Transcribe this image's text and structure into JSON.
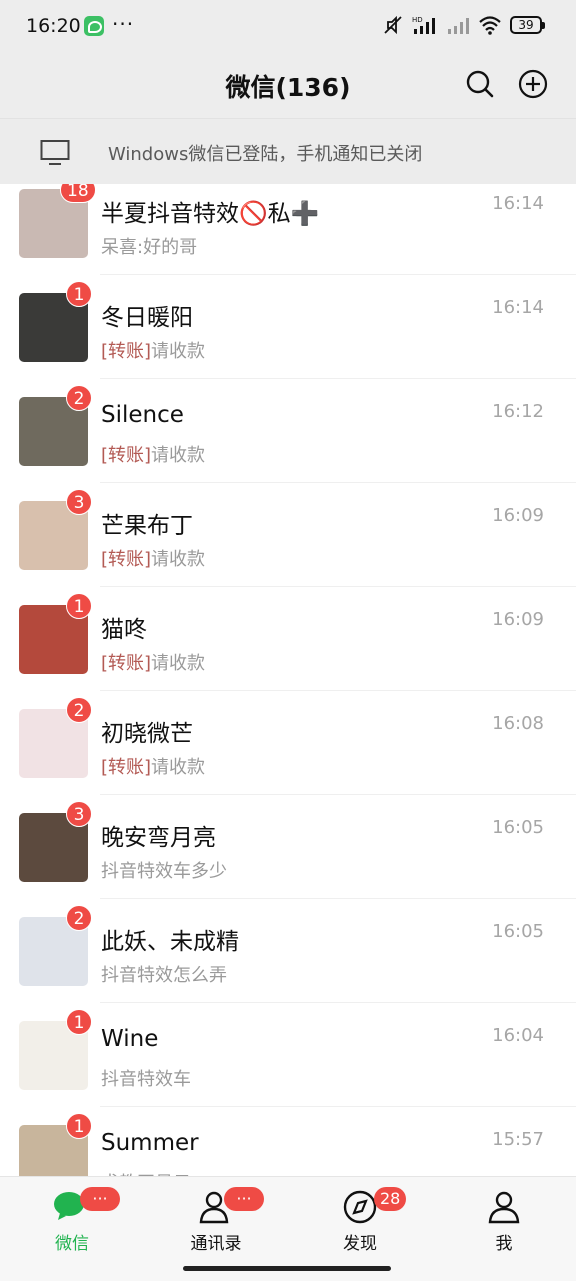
{
  "status": {
    "time": "16:20",
    "dots": "···",
    "battery": "39"
  },
  "header": {
    "title": "微信(136)"
  },
  "notice": {
    "text": "Windows微信已登陆，手机通知已关闭"
  },
  "chats": [
    {
      "name": "半夏抖音特效🚫私➕",
      "tag": "",
      "preview": "呆喜:好的哥",
      "time": "16:14",
      "badge": "18",
      "avatar_color": "#c9b9b3"
    },
    {
      "name": "冬日暖阳",
      "tag": "[转账]",
      "preview": "请收款",
      "time": "16:14",
      "badge": "1",
      "avatar_color": "#3a3a38"
    },
    {
      "name": "Silence",
      "tag": "[转账]",
      "preview": "请收款",
      "time": "16:12",
      "badge": "2",
      "avatar_color": "#6f6a5e"
    },
    {
      "name": "芒果布丁",
      "tag": "[转账]",
      "preview": "请收款",
      "time": "16:09",
      "badge": "3",
      "avatar_color": "#d8c0ad"
    },
    {
      "name": "猫咚",
      "tag": "[转账]",
      "preview": "请收款",
      "time": "16:09",
      "badge": "1",
      "avatar_color": "#b4493c"
    },
    {
      "name": "初晓微芒",
      "tag": "[转账]",
      "preview": "请收款",
      "time": "16:08",
      "badge": "2",
      "avatar_color": "#f1e2e4"
    },
    {
      "name": "晚安弯月亮",
      "tag": "",
      "preview": "抖音特效车多少",
      "time": "16:05",
      "badge": "3",
      "avatar_color": "#5c4a3e"
    },
    {
      "name": "此妖、未成精",
      "tag": "",
      "preview": "抖音特效怎么弄",
      "time": "16:05",
      "badge": "2",
      "avatar_color": "#dfe3ea"
    },
    {
      "name": "Wine",
      "tag": "",
      "preview": "抖音特效车",
      "time": "16:04",
      "badge": "1",
      "avatar_color": "#f2efe9"
    },
    {
      "name": "Summer",
      "tag": "",
      "preview": "求教网易云",
      "time": "15:57",
      "badge": "1",
      "avatar_color": "#c8b59c"
    }
  ],
  "tabs": [
    {
      "label": "微信",
      "badge": "···",
      "active": true,
      "icon": "chat-bubble-icon"
    },
    {
      "label": "通讯录",
      "badge": "···",
      "active": false,
      "icon": "contacts-icon"
    },
    {
      "label": "发现",
      "badge": "28",
      "active": false,
      "icon": "compass-icon"
    },
    {
      "label": "我",
      "badge": "",
      "active": false,
      "icon": "person-icon"
    }
  ],
  "colors": {
    "accent": "#21b34f",
    "badge": "#ef4b45",
    "transfer_tag": "#b35a54"
  }
}
